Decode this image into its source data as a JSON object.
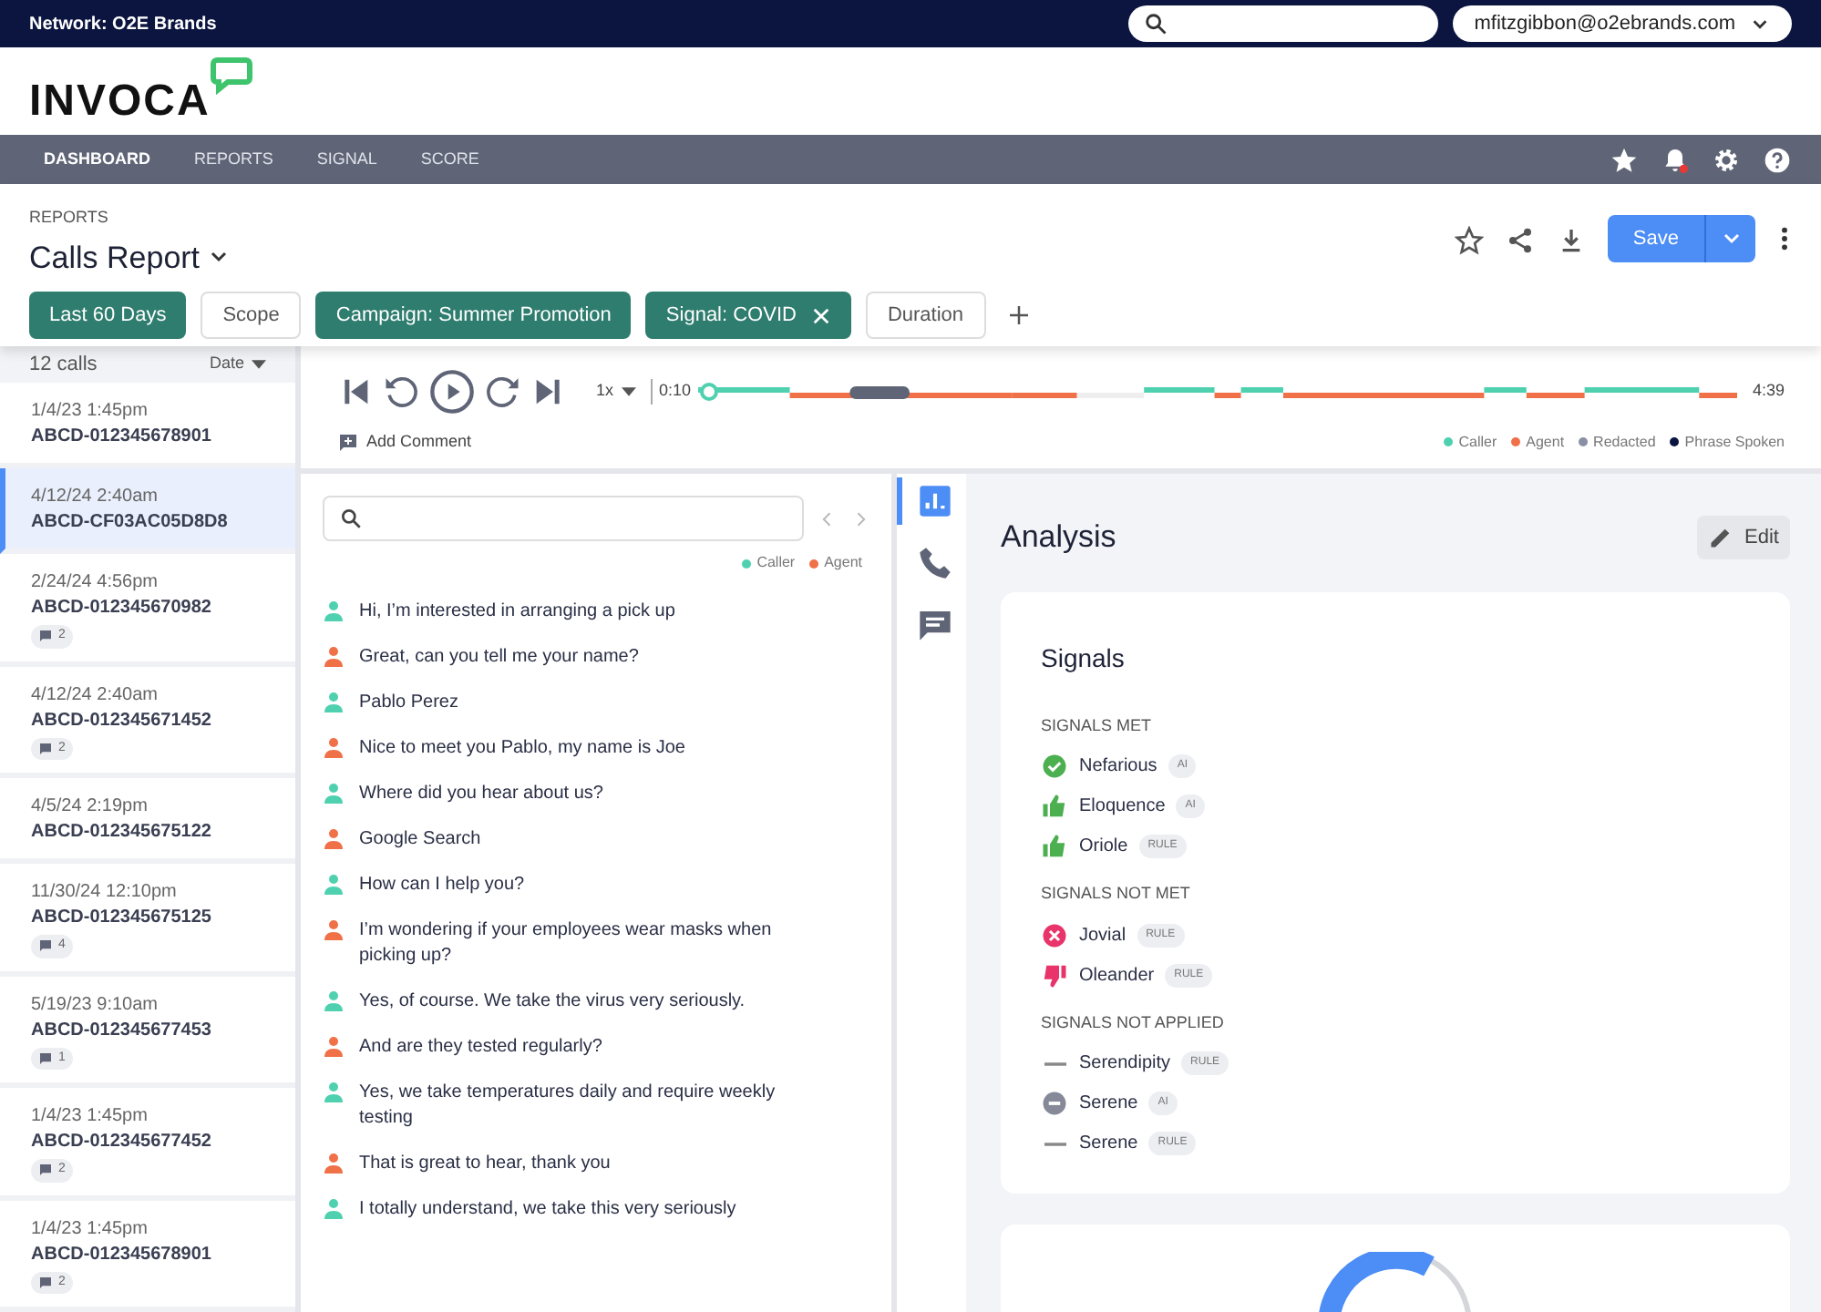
{
  "topbar": {
    "network": "Network: O2E Brands",
    "account": "mfitzgibbon@o2ebrands.com"
  },
  "logo": {
    "text": "INVOCA"
  },
  "nav": {
    "items": [
      {
        "label": "DASHBOARD",
        "selected": true
      },
      {
        "label": "REPORTS",
        "selected": false
      },
      {
        "label": "SIGNAL",
        "selected": false
      },
      {
        "label": "SCORE",
        "selected": false
      }
    ],
    "notification_dot": true
  },
  "header": {
    "breadcrumb": "REPORTS",
    "title": "Calls Report",
    "save": "Save",
    "filters": [
      {
        "label": "Last 60 Days",
        "active": true,
        "removable": false
      },
      {
        "label": "Scope",
        "active": false,
        "removable": false
      },
      {
        "label": "Campaign: Summer Promotion",
        "active": true,
        "removable": false
      },
      {
        "label": "Signal: COVID",
        "active": true,
        "removable": true
      },
      {
        "label": "Duration",
        "active": false,
        "removable": false
      }
    ]
  },
  "call_list": {
    "count": "12 calls",
    "sort": "Date",
    "items": [
      {
        "date": "1/4/23 1:45pm",
        "id": "ABCD-012345678901",
        "selected": false
      },
      {
        "date": "4/12/24 2:40am",
        "id": "ABCD-CF03AC05D8D8",
        "selected": true
      },
      {
        "date": "2/24/24 4:56pm",
        "id": "ABCD-012345670982",
        "comments": "2",
        "selected": false
      },
      {
        "date": "4/12/24 2:40am",
        "id": "ABCD-012345671452",
        "comments": "2",
        "selected": false
      },
      {
        "date": "4/5/24 2:19pm",
        "id": "ABCD-012345675122",
        "selected": false
      },
      {
        "date": "11/30/24 12:10pm",
        "id": "ABCD-012345675125",
        "comments": "4",
        "selected": false
      },
      {
        "date": "5/19/23 9:10am",
        "id": "ABCD-012345677453",
        "comments": "1",
        "selected": false
      },
      {
        "date": "1/4/23 1:45pm",
        "id": "ABCD-012345677452",
        "comments": "2",
        "selected": false
      },
      {
        "date": "1/4/23 1:45pm",
        "id": "ABCD-012345678901",
        "comments": "2",
        "selected": false
      }
    ]
  },
  "player": {
    "speed": "1x",
    "elapsed": "0:10",
    "total": "4:39",
    "level": 0.01,
    "add_comment": "Add Comment",
    "legend": [
      {
        "label": "Caller",
        "color": "#4fd1b0"
      },
      {
        "label": "Agent",
        "color": "#f07048"
      },
      {
        "label": "Redacted",
        "color": "#8a8fa3"
      },
      {
        "label": "Phrase Spoken",
        "color": "#0b1540"
      }
    ]
  },
  "transcript": {
    "legend": [
      {
        "label": "Caller",
        "color": "#4fd1b0"
      },
      {
        "label": "Agent",
        "color": "#f07048"
      }
    ],
    "lines": [
      {
        "kind": "caller",
        "text": "Hi, I’m interested in arranging a pick up"
      },
      {
        "kind": "agent",
        "text": "Great, can you tell me your name?"
      },
      {
        "kind": "caller",
        "text": "Pablo Perez"
      },
      {
        "kind": "agent",
        "text": "Nice to meet you Pablo, my name is Joe"
      },
      {
        "kind": "caller",
        "text": "Where did you hear about us?"
      },
      {
        "kind": "agent",
        "text": "Google Search"
      },
      {
        "kind": "caller",
        "text": "How can I help you?"
      },
      {
        "kind": "agent",
        "text": "I’m wondering if your employees wear masks when picking up?"
      },
      {
        "kind": "caller",
        "text": "Yes, of course. We take the virus very seriously."
      },
      {
        "kind": "agent",
        "text": "And are they tested regularly?"
      },
      {
        "kind": "caller",
        "text": "Yes, we take temperatures daily and require weekly testing"
      },
      {
        "kind": "agent",
        "text": "That is great to hear, thank you"
      },
      {
        "kind": "caller",
        "text": "I totally understand, we take this very seriously"
      }
    ]
  },
  "side_tabs": [
    {
      "kind": "chart",
      "selected": true
    },
    {
      "kind": "phone",
      "selected": false
    },
    {
      "kind": "comment",
      "selected": false
    }
  ],
  "analysis": {
    "title": "Analysis",
    "edit": "Edit",
    "card_title": "Signals",
    "groups": [
      {
        "title": "SIGNALS MET",
        "items": [
          {
            "kind": "check",
            "name": "Nefarious",
            "tag": "AI"
          },
          {
            "kind": "thumbs_up",
            "name": "Eloquence",
            "tag": "AI"
          },
          {
            "kind": "thumbs_up",
            "name": "Oriole",
            "tag": "RULE"
          }
        ]
      },
      {
        "title": "SIGNALS NOT MET",
        "items": [
          {
            "kind": "cross",
            "name": "Jovial",
            "tag": "RULE"
          },
          {
            "kind": "thumbs_down",
            "name": "Oleander",
            "tag": "RULE"
          }
        ]
      },
      {
        "title": "SIGNALS NOT APPLIED",
        "items": [
          {
            "kind": "dash",
            "name": "Serendipity",
            "tag": "RULE"
          },
          {
            "kind": "minus_circle",
            "name": "Serene",
            "tag": "AI"
          },
          {
            "kind": "dash",
            "name": "Serene",
            "tag": "RULE"
          }
        ]
      }
    ]
  }
}
